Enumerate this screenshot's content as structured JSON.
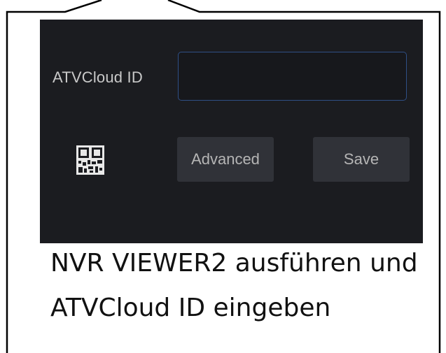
{
  "app": {
    "cloud_id_label": "ATVCloud ID",
    "cloud_id_value": "",
    "advanced_label": "Advanced",
    "save_label": "Save"
  },
  "caption": {
    "line1": "NVR VIEWER2 ausführen und",
    "line2": "ATVCloud ID eingeben"
  },
  "colors": {
    "panel_bg": "#1b1c20",
    "input_border": "#2f4f86",
    "button_bg": "#303238",
    "button_text": "#b5b5b5"
  },
  "icons": [
    "qr-code-icon"
  ]
}
